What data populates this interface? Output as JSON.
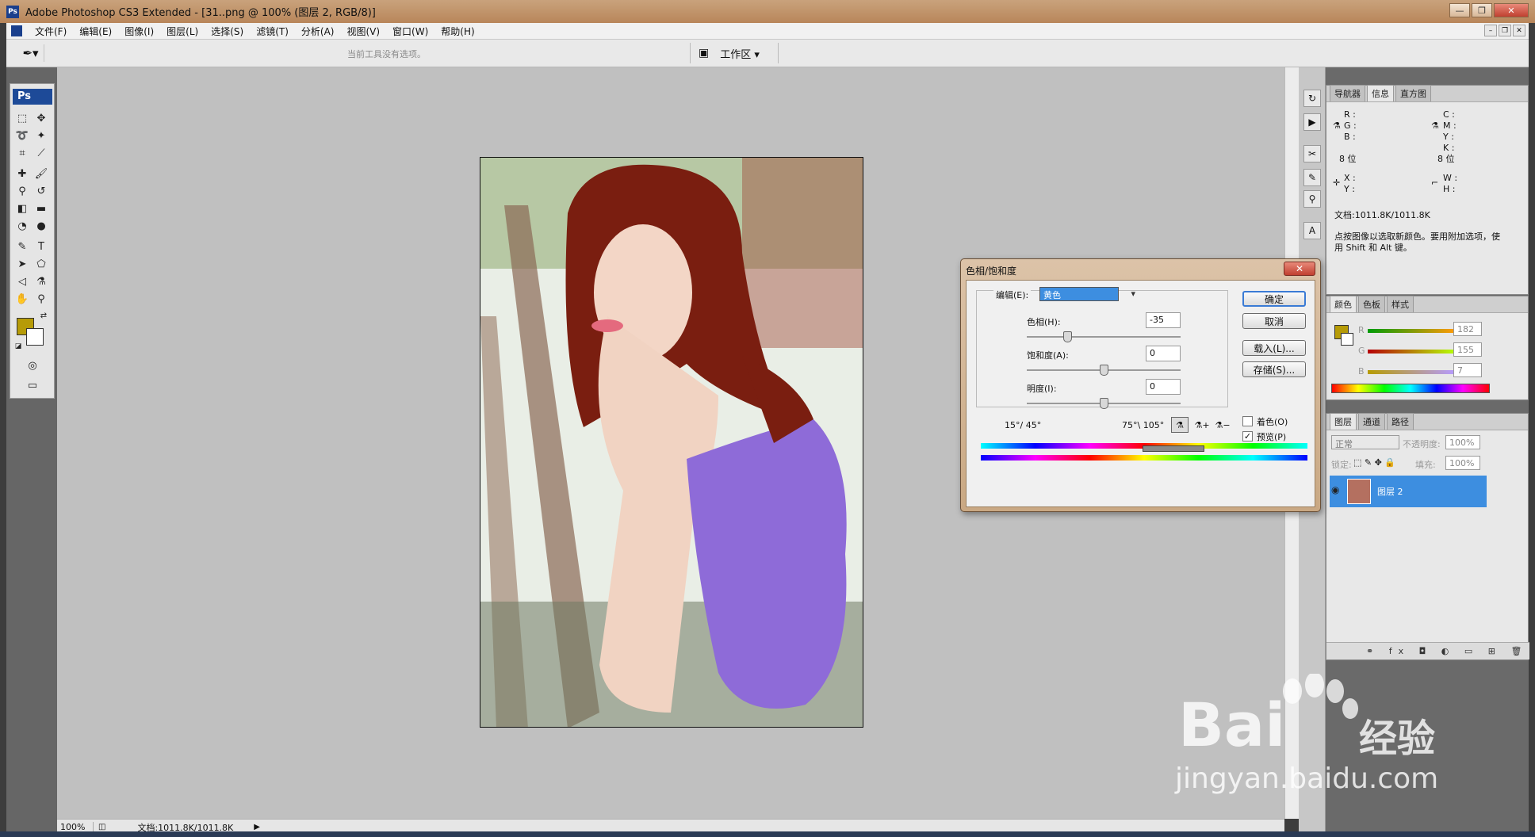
{
  "window": {
    "title": "Adobe Photoshop CS3 Extended - [31..png @ 100% (图层 2, RGB/8)]",
    "controls": [
      "—",
      "❐",
      "✕"
    ]
  },
  "menubar": {
    "items": [
      "文件(F)",
      "编辑(E)",
      "图像(I)",
      "图层(L)",
      "选择(S)",
      "滤镜(T)",
      "分析(A)",
      "视图(V)",
      "窗口(W)",
      "帮助(H)"
    ]
  },
  "options_bar": {
    "hint": "当前工具没有选项。",
    "workspace_label": "工作区 ▾"
  },
  "toolbox": {
    "logo": "Ps",
    "foreground_color": "#b69b07",
    "background_color": "#ffffff"
  },
  "status": {
    "zoom": "100%",
    "doc_size": "文档:1011.8K/1011.8K"
  },
  "info_panel": {
    "tabs": [
      "导航器",
      "信息",
      "直方图"
    ],
    "rgb_labels": [
      "R :",
      "G :",
      "B :"
    ],
    "cmyk_labels": [
      "C :",
      "M :",
      "Y :",
      "K :"
    ],
    "bit_left": "8 位",
    "bit_right": "8 位",
    "xy_labels": [
      "X :",
      "Y :"
    ],
    "wh_labels": [
      "W :",
      "H :"
    ],
    "doc": "文档:1011.8K/1011.8K",
    "help_line1": "点按图像以选取新颜色。要用附加选项，使",
    "help_line2": "用 Shift 和 Alt 键。"
  },
  "color_panel": {
    "tabs": [
      "颜色",
      "色板",
      "样式"
    ],
    "r_label": "R",
    "g_label": "G",
    "b_label": "B",
    "r_value": "182",
    "g_value": "155",
    "b_value": "7"
  },
  "layers_panel": {
    "tabs": [
      "图层",
      "通道",
      "路径"
    ],
    "blend_mode": "正常",
    "opacity_label": "不透明度:",
    "opacity_value": "100%",
    "lock_label": "锁定:",
    "fill_label": "填充:",
    "fill_value": "100%",
    "layer_name": "图层 2"
  },
  "dialog": {
    "title": "色相/饱和度",
    "edit_label": "编辑(E):",
    "edit_value": "黄色",
    "hue_label": "色相(H):",
    "hue_value": "-35",
    "sat_label": "饱和度(A):",
    "sat_value": "0",
    "light_label": "明度(I):",
    "light_value": "0",
    "range_left": "15°/ 45°",
    "range_right": "75°\\ 105°",
    "ok": "确定",
    "cancel": "取消",
    "load": "载入(L)...",
    "save": "存储(S)...",
    "colorize": "着色(O)",
    "preview": "预览(P)",
    "preview_checked": "✓"
  },
  "watermark": {
    "brand": "Bai",
    "brand2": "经验",
    "url": "jingyan.baidu.com"
  }
}
